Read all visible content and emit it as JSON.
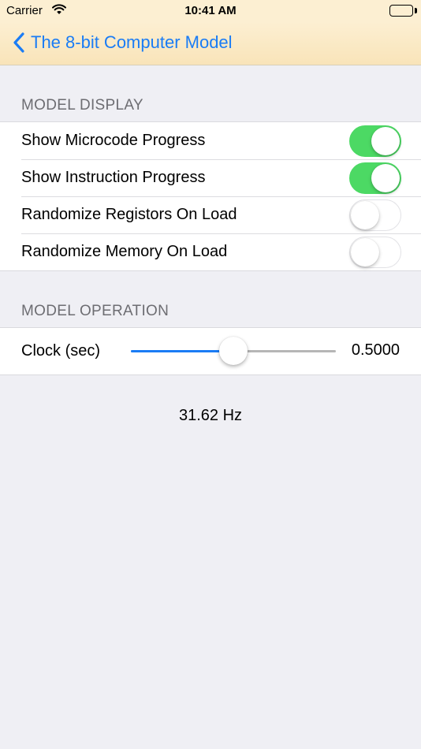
{
  "status_bar": {
    "carrier": "Carrier",
    "time": "10:41 AM"
  },
  "nav": {
    "back_label": "The 8-bit Computer Model"
  },
  "colors": {
    "accent": "#1a7cf5",
    "toggle_on": "#4cd964",
    "nav_background": "#fcefd2"
  },
  "model_display": {
    "header": "MODEL DISPLAY",
    "items": [
      {
        "label": "Show Microcode Progress",
        "on": true
      },
      {
        "label": "Show Instruction Progress",
        "on": true
      },
      {
        "label": "Randomize Registors On Load",
        "on": false
      },
      {
        "label": "Randomize Memory On Load",
        "on": false
      }
    ]
  },
  "model_operation": {
    "header": "MODEL OPERATION",
    "clock": {
      "label": "Clock (sec)",
      "value_text": "0.5000",
      "slider_fraction": 0.5
    }
  },
  "frequency_text": "31.62 Hz"
}
